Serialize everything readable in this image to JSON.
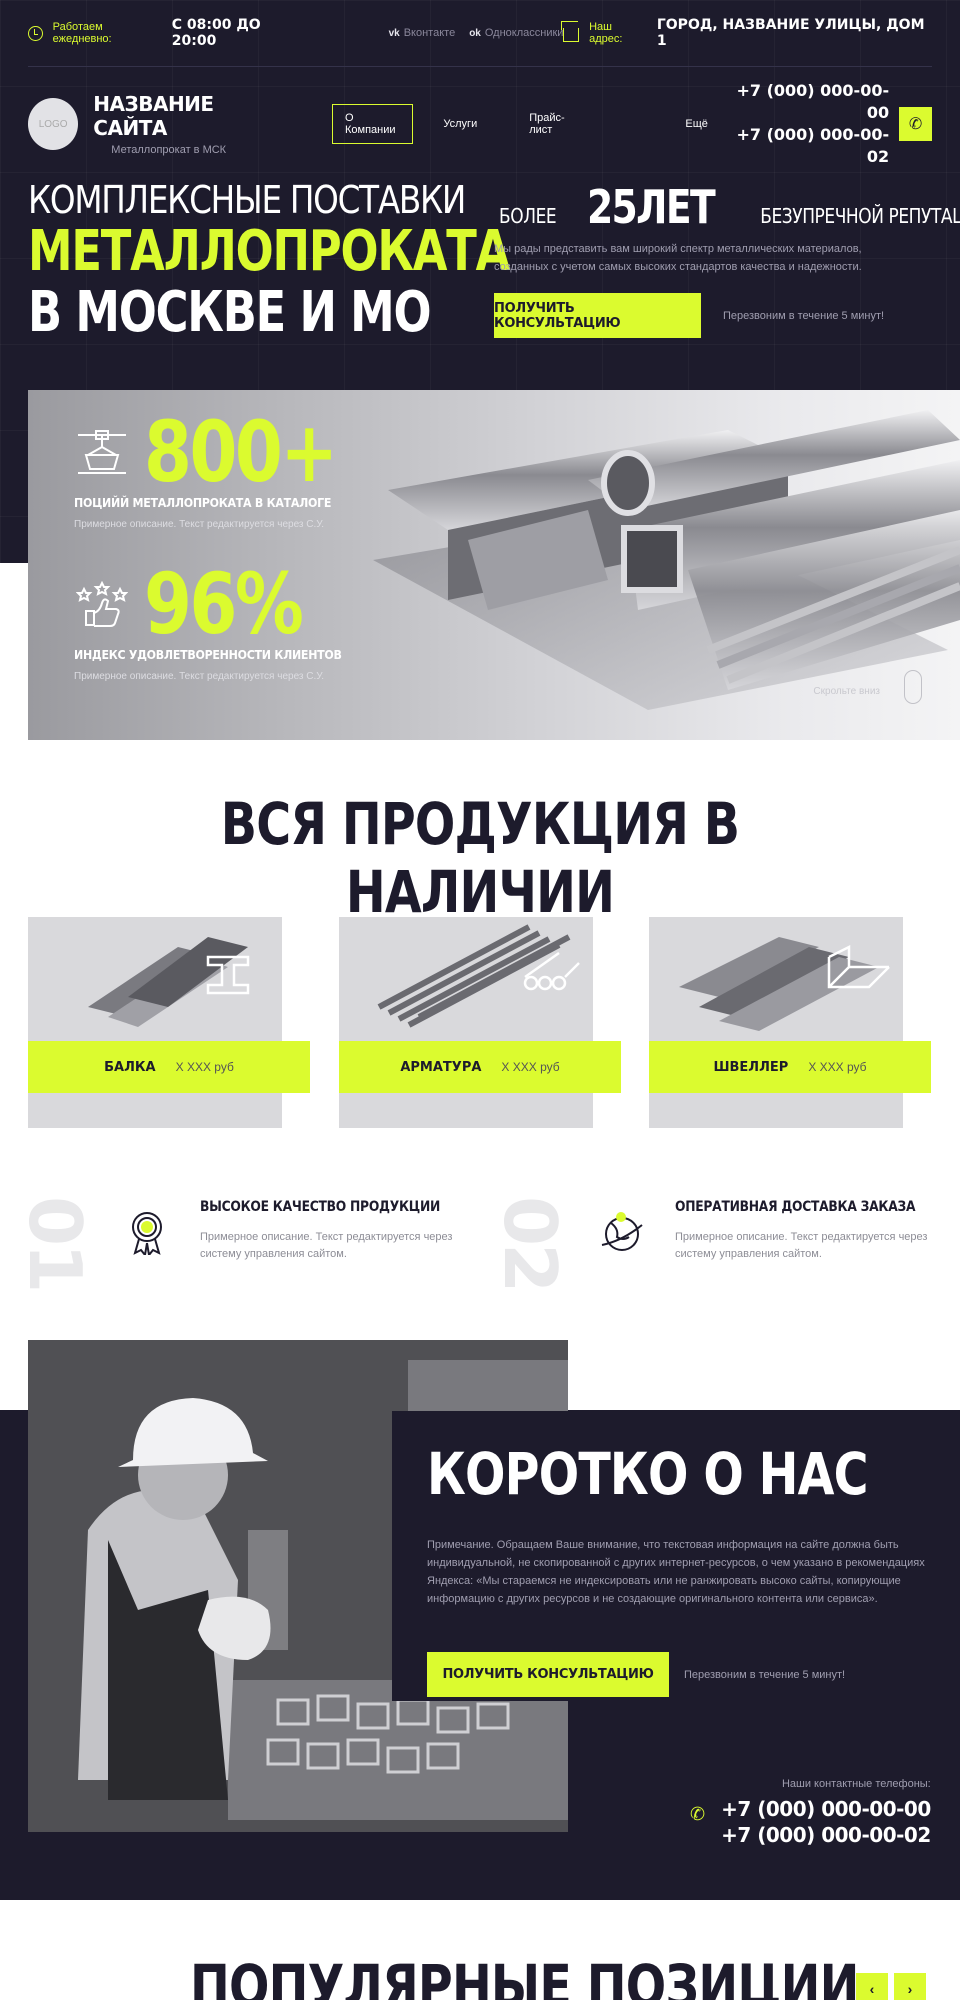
{
  "topbar": {
    "hours_label": "Работаем ежедневно:",
    "hours_value": "С 08:00 ДО 20:00",
    "vk_label": "Вконтакте",
    "ok_label": "Одноклассники",
    "address_label": "Наш адрес:",
    "address_value": "ГОРОД, НАЗВАНИЕ УЛИЦЫ, ДОМ 1"
  },
  "header": {
    "logo": "LOGO",
    "site_name": "НАЗВАНИЕ САЙТА",
    "site_sub": "Металлопрокат в МСК",
    "nav": [
      "О Компании",
      "Услуги",
      "Прайс-лист",
      "Ещё"
    ],
    "phone1": "+7 (000) 000-00-00",
    "phone2": "+7 (000) 000-00-02"
  },
  "hero": {
    "line1": "КОМПЛЕКСНЫЕ ПОСТАВКИ",
    "line2": "МЕТАЛЛОПРОКАТА",
    "line3": "В МОСКВЕ И МО",
    "years_pre": "БОЛЕЕ",
    "years_big": "25ЛЕТ",
    "years_post": "БЕЗУПРЕЧНОЙ РЕПУТАЦИИ",
    "description": "Мы рады представить вам широкий спектр металлических материалов, созданных с учетом самых высоких стандартов качества и надежности.",
    "cta": "ПОЛУЧИТЬ КОНСУЛЬТАЦИЮ",
    "cta_note": "Перезвоним в течение 5 минут!"
  },
  "stats": [
    {
      "value": "800+",
      "label": "ПОЦИЙЙ МЕТАЛЛОПРОКАТА В КАТАЛОГЕ",
      "sub": "Примерное описание. Текст редактируется через С.У."
    },
    {
      "value": "96%",
      "label": "ИНДЕКС УДОВЛЕТВОРЕННОСТИ КЛИЕНТОВ",
      "sub": "Примерное описание. Текст редактируется через С.У."
    }
  ],
  "scroll_hint": "Скрольте вниз",
  "products_title": "ВСЯ ПРОДУКЦИЯ В НАЛИЧИИ",
  "products": [
    {
      "name": "БАЛКА",
      "price": "Х ХХХ руб"
    },
    {
      "name": "АРМАТУРА",
      "price": "Х ХХХ руб"
    },
    {
      "name": "ШВЕЛЛЕР",
      "price": "Х ХХХ руб"
    }
  ],
  "features": [
    {
      "num": "01",
      "title": "ВЫСОКОЕ КАЧЕСТВО ПРОДУКЦИИ",
      "desc": "Примерное описание. Текст редактируется через систему управления сайтом."
    },
    {
      "num": "02",
      "title": "ОПЕРАТИВНАЯ ДОСТАВКА ЗАКАЗА",
      "desc": "Примерное описание. Текст редактируется через систему управления сайтом."
    }
  ],
  "about": {
    "title": "КОРОТКО О НАС",
    "text": "Примечание. Обращаем Ваше внимание, что текстовая информация на сайте должна быть индивидуальной, не скопированной с других интернет-ресурсов, о чем указано в рекомендациях Яндекса: «Мы стараемся не индексировать или не ранжировать высоко сайты, копирующие информацию с других ресурсов и не создающие оригинального контента или сервиса».",
    "cta": "ПОЛУЧИТЬ КОНСУЛЬТАЦИЮ",
    "cta_note": "Перезвоним в течение 5 минут!",
    "contacts_label": "Наши контактные телефоны:",
    "phone1": "+7 (000) 000-00-00",
    "phone2": "+7 (000) 000-00-02"
  },
  "popular_title": "ПОПУЛЯРНЫЕ ПОЗИЦИИ",
  "colors": {
    "accent": "#dbfb2f",
    "dark": "#1d1b2c"
  }
}
